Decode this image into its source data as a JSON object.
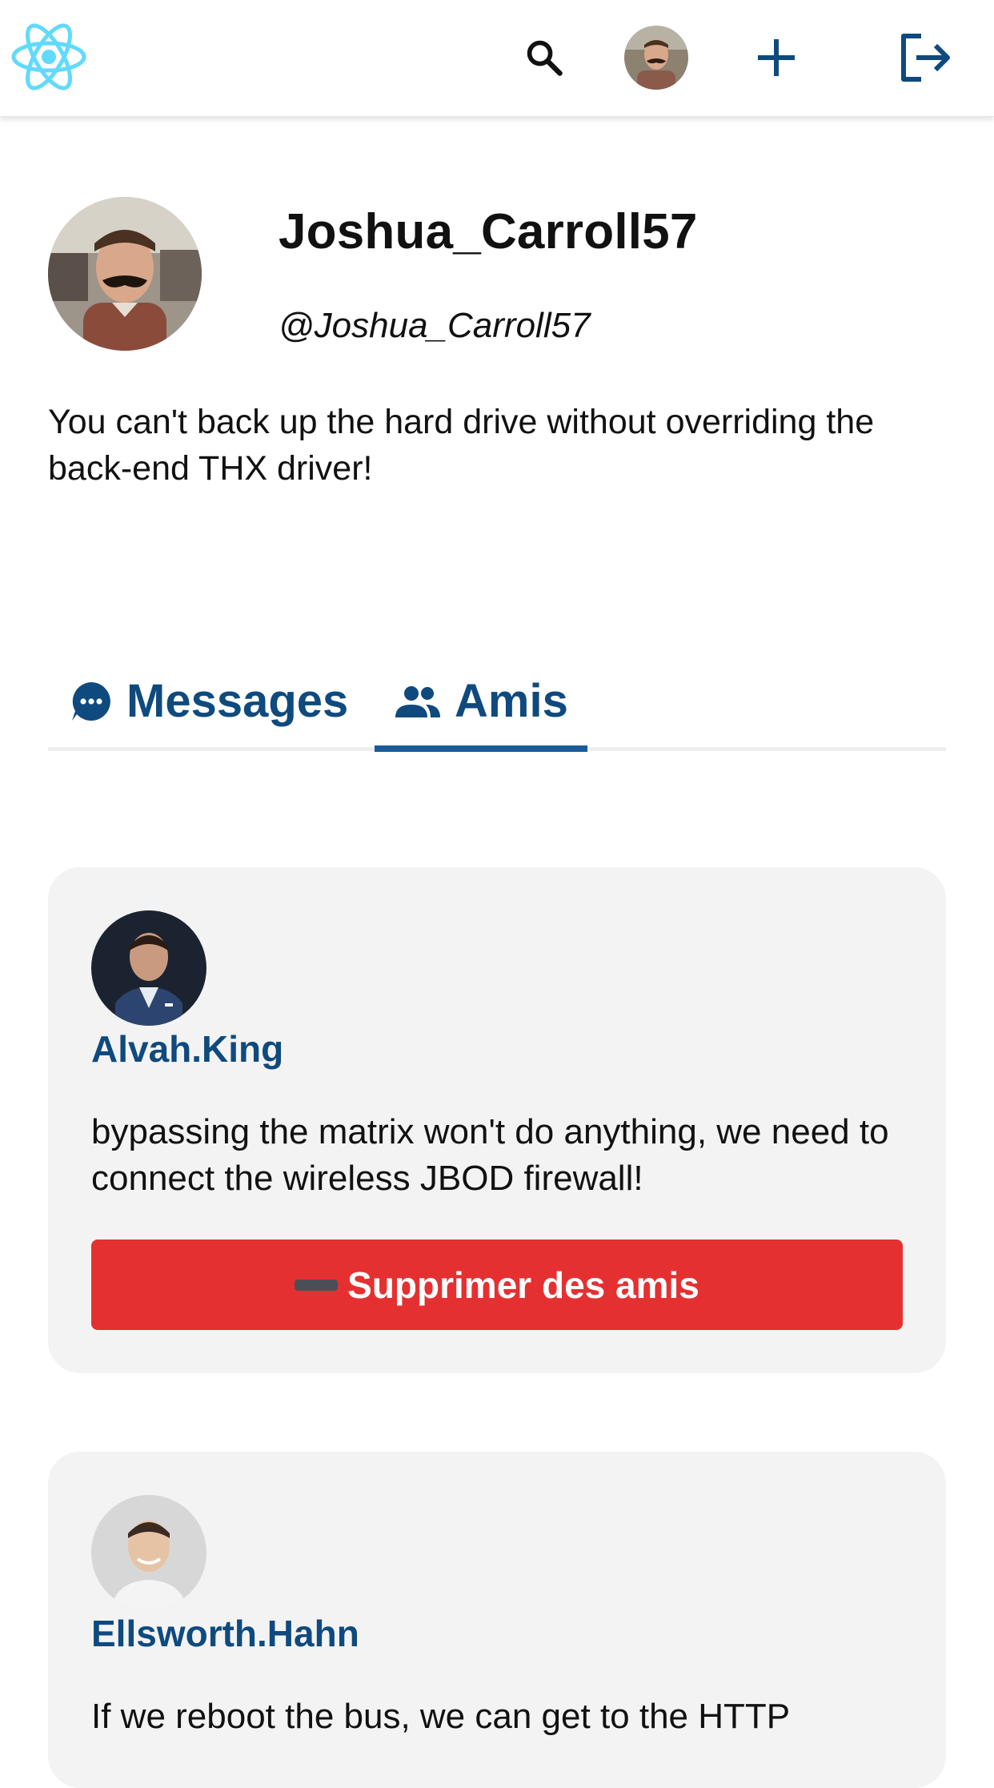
{
  "nav": {
    "logo_icon": "react-logo-icon",
    "search_icon": "search-icon",
    "add_icon": "plus-icon",
    "logout_icon": "logout-icon"
  },
  "profile": {
    "name": "Joshua_Carroll57",
    "handle": "@Joshua_Carroll57",
    "bio": "You can't back up the hard drive without overriding the back-end THX driver!"
  },
  "tabs": [
    {
      "label": "Messages",
      "icon": "chat-bubble-icon",
      "active": false
    },
    {
      "label": "Amis",
      "icon": "people-icon",
      "active": true
    }
  ],
  "friends": [
    {
      "name": "Alvah.King",
      "bio": "bypassing the matrix won't do anything, we need to connect the wireless JBOD firewall!",
      "button_label": "Supprimer des amis",
      "button_icon": "minus-emoji-icon"
    },
    {
      "name": "Ellsworth.Hahn",
      "bio": "If we reboot the bus, we can get to the HTTP"
    }
  ],
  "colors": {
    "accent": "#0f4a7e",
    "tab_underline": "#1a5c9a",
    "danger": "#e53031",
    "card_bg": "#f3f3f3",
    "logo": "#61dafb"
  }
}
